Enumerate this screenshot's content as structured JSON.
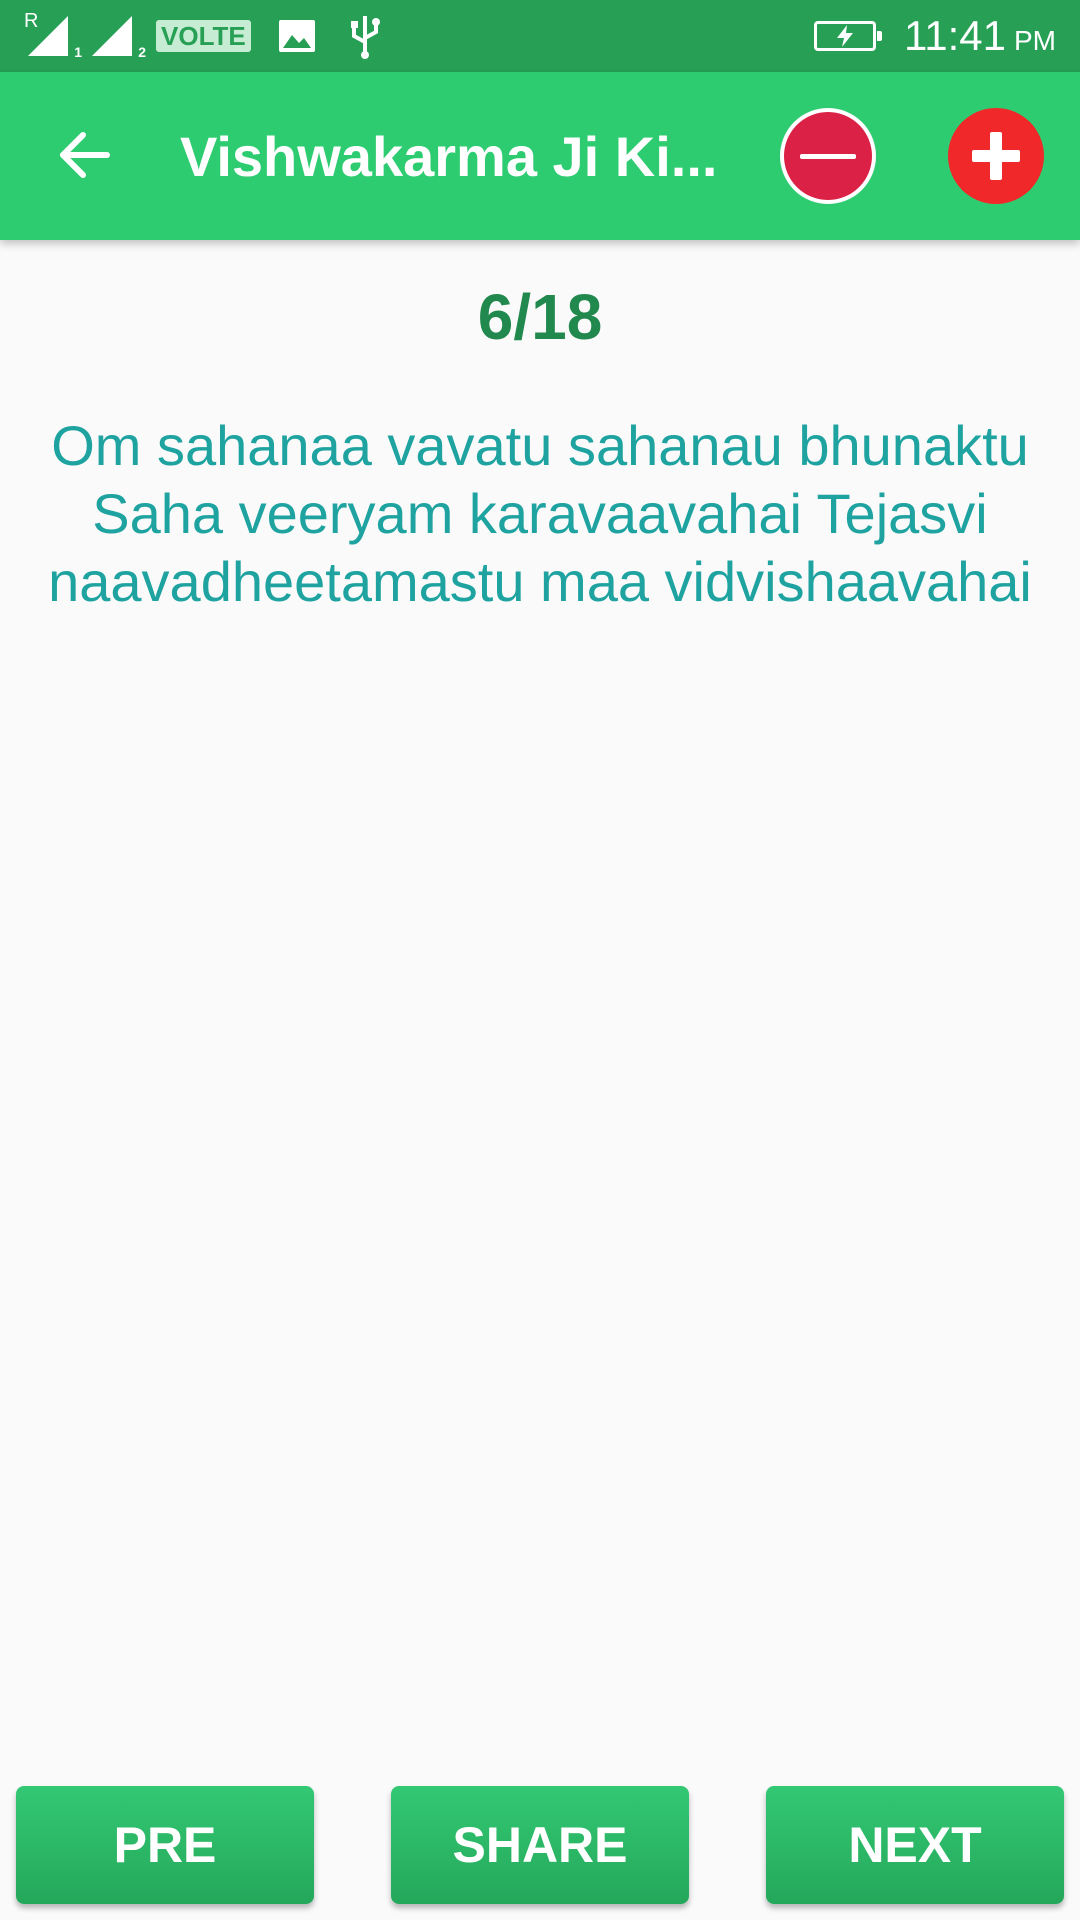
{
  "status_bar": {
    "sim1_roaming": "R",
    "sim1_index": "1",
    "sim2_index": "2",
    "volte": "VOLTE",
    "time": "11:41",
    "ampm": "PM"
  },
  "app_bar": {
    "title": "Vishwakarma Ji Ki...",
    "back_icon": "arrow-left-icon",
    "zoom_out_icon": "minus-circle-icon",
    "zoom_in_icon": "plus-circle-icon"
  },
  "content": {
    "counter": "6/18",
    "verse": "Om sahanaa vavatu sahanau bhunaktu Saha veeryam karavaavahai Tejasvi naavadheetamastu maa vidvishaavahai"
  },
  "buttons": {
    "pre": "PRE",
    "share": "SHARE",
    "next": "NEXT"
  },
  "colors": {
    "status_bar": "#27a055",
    "app_bar": "#2ecc71",
    "counter_text": "#21884e",
    "verse_text": "#1ea3a0",
    "zoom_out": "#dc2147",
    "zoom_in": "#f0282a",
    "button": "#2bb866"
  }
}
